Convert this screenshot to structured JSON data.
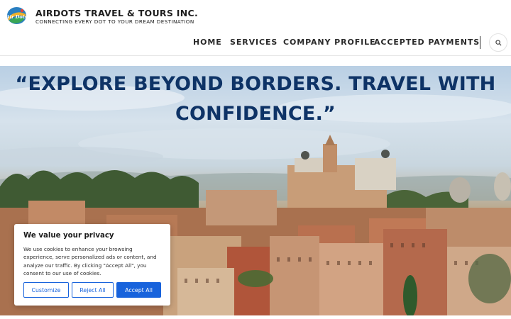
{
  "brand": {
    "name": "AIRDOTS TRAVEL & TOURS INC.",
    "tagline": "CONNECTING EVERY DOT TO YOUR DREAM DESTINATION",
    "logo_text": "Air Dots"
  },
  "nav": {
    "items": [
      {
        "label": "HOME"
      },
      {
        "label": "SERVICES"
      },
      {
        "label": "COMPANY PROFILE"
      },
      {
        "label": "ACCEPTED PAYMENTS"
      }
    ],
    "search_icon": "search-icon"
  },
  "hero": {
    "line1": "“EXPLORE BEYOND BORDERS. TRAVEL WITH",
    "line2": "CONFIDENCE.”"
  },
  "cookie": {
    "title": "We value your privacy",
    "body": "We use cookies to enhance your browsing experience, serve personalized ads or content, and analyze our traffic. By clicking \"Accept All\", you consent to our use of cookies.",
    "customize": "Customize",
    "reject": "Reject All",
    "accept": "Accept All"
  },
  "colors": {
    "headline": "#0e3366",
    "accent": "#1863dc"
  }
}
